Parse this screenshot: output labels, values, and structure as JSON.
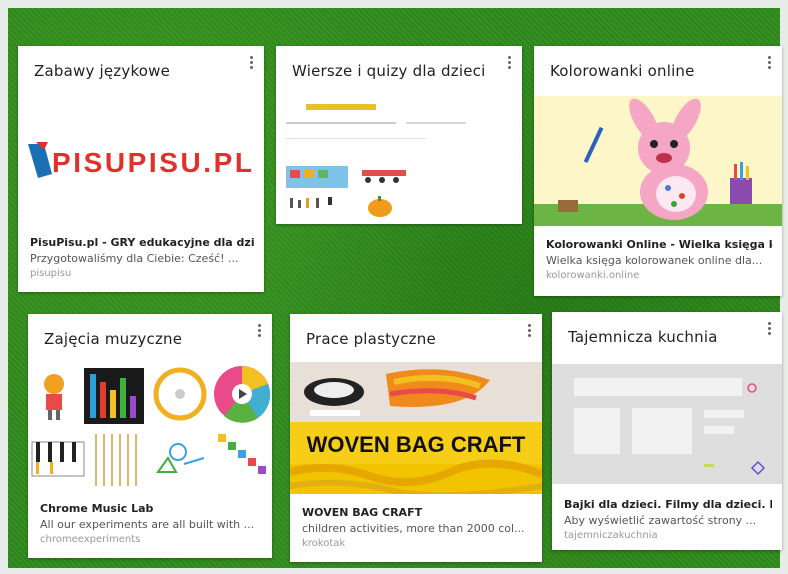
{
  "cards": [
    {
      "title": "Zabawy językowe",
      "logo": "PISUPISU.PL",
      "link_title": "PisuPisu.pl - GRY edukacyjne dla dzi...",
      "link_desc": "Przygotowaliśmy dla Ciebie: Cześć! ...",
      "link_domain": "pisupisu"
    },
    {
      "title": "Wiersze i quizy dla dzieci"
    },
    {
      "title": "Kolorowanki online",
      "link_title": "Kolorowanki Online - Wielka księga k...",
      "link_desc": "Wielka księga kolorowanek online dla...",
      "link_domain": "kolorowanki.online"
    },
    {
      "title": "Zajęcia muzyczne",
      "link_title": "Chrome Music Lab",
      "link_desc": "All our experiments are all built with ...",
      "link_domain": "chromeexperiments"
    },
    {
      "title": "Prace plastyczne",
      "banner": "WOVEN BAG CRAFT",
      "link_title": "WOVEN BAG CRAFT",
      "link_desc": "children activities, more than 2000 col...",
      "link_domain": "krokotak"
    },
    {
      "title": "Tajemnicza kuchnia",
      "link_title": "Bajki dla dzieci. Filmy dla dzieci. K...",
      "link_desc": "Aby wyświetlić zawartość strony ...",
      "link_domain": "tajemniczakuchnia"
    }
  ],
  "colors": {
    "board": "#2f8a1c",
    "pink_bg": "#fdf6c8",
    "craft_bg": "#e6d6c6",
    "kitchen_bg": "#dedede"
  }
}
